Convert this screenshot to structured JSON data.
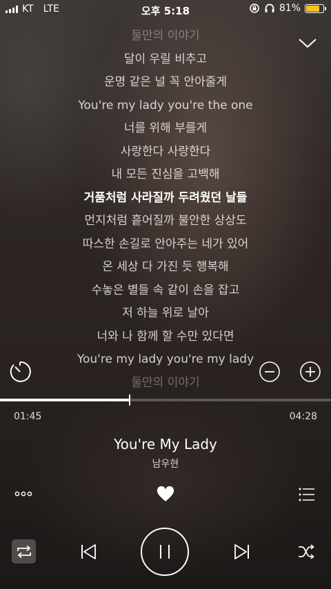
{
  "status_bar": {
    "carrier": "KT",
    "network": "LTE",
    "time": "오후 5:18",
    "battery_percent": "81%",
    "battery_level": 0.81,
    "battery_color": "#f5c518"
  },
  "lyrics": [
    "둘만의 이야기",
    "달이 우릴 비추고",
    "운명 같은 널 꼭 안아줄게",
    "You're my lady you're the one",
    "너를 위해 부를게",
    "사랑한다 사랑한다",
    "내 모든 진심을 고백해",
    "거품처럼 사라질까 두려웠던 날들",
    "먼지처럼 흩어질까 불안한 상상도",
    "따스한 손길로 안아주는 네가 있어",
    "온 세상 다 가진 듯 행복해",
    "수놓은 별들 속 같이 손을 잡고",
    "저 하늘 위로 날아",
    "너와 나 함께 할 수만 있다면",
    "You're my lady you're my lady",
    "둘만의 이야기"
  ],
  "current_lyric_index": 7,
  "playback": {
    "elapsed": "01:45",
    "total": "04:28",
    "progress": 0.392
  },
  "track": {
    "title": "You're My Lady",
    "artist": "남우현"
  },
  "icons": {
    "collapse": "chevron-down-icon",
    "timer": "timer-icon",
    "minus": "minus-circle-icon",
    "plus": "plus-circle-icon",
    "more": "more-icon",
    "heart": "heart-icon",
    "playlist": "playlist-icon",
    "repeat": "repeat-icon",
    "previous": "previous-icon",
    "pause": "pause-icon",
    "next": "next-icon",
    "shuffle": "shuffle-icon"
  }
}
